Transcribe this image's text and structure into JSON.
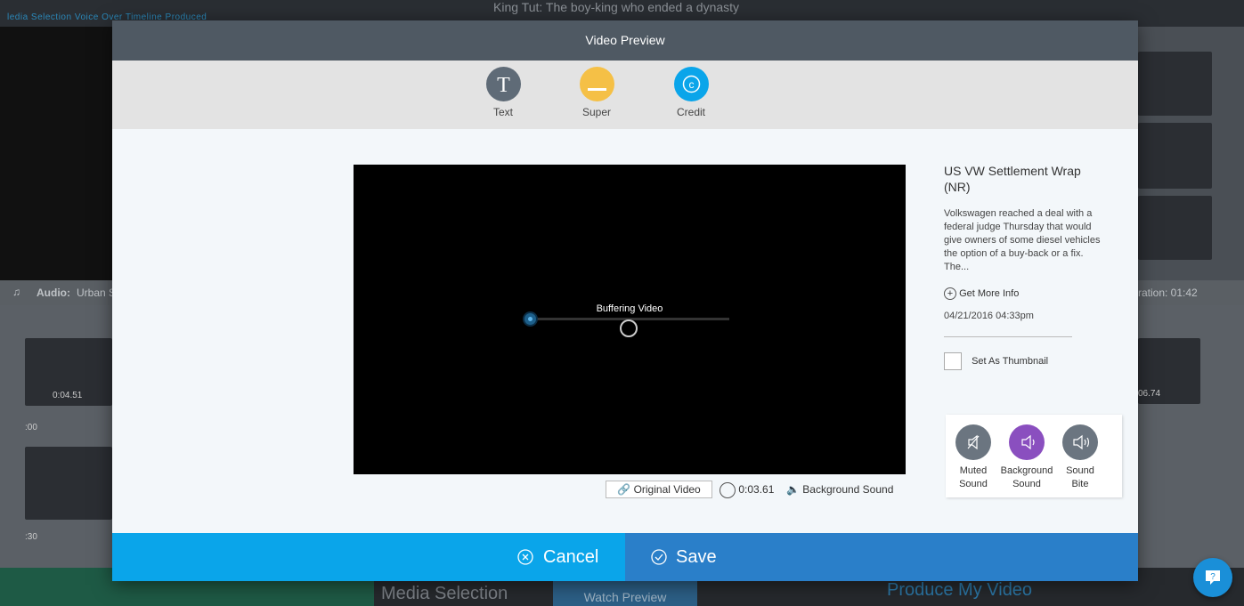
{
  "background": {
    "steps": "ledia Selection  Voice Over    Timeline     Produced",
    "project_title": "King Tut: The boy-king who ended a dynasty",
    "audio_label": "Audio:",
    "audio_value": "Urban S",
    "duration_label": "ration: 01:42",
    "clip1_time": "0:04.51",
    "clip2_time": "06.74",
    "tick1": ":00",
    "tick2": ":30",
    "footer_media": "Media Selection",
    "footer_watch": "Watch Preview",
    "footer_produce": "Produce My Video"
  },
  "modal": {
    "title": "Video Preview",
    "tools": [
      {
        "label": "Text",
        "color": "#5f6b77",
        "icon": "text-icon"
      },
      {
        "label": "Super",
        "color": "#f5c046",
        "icon": "super-icon"
      },
      {
        "label": "Credit",
        "color": "#0aa5ea",
        "icon": "copyright-icon"
      }
    ],
    "player": {
      "buffering_text": "Buffering Video"
    },
    "info": {
      "original_video": "Original Video",
      "duration": "0:03.61",
      "sound_type": "Background Sound"
    },
    "side": {
      "title": "US VW Settlement Wrap (NR)",
      "description": "Volkswagen reached a deal with a federal judge Thursday that would give owners of some diesel vehicles the option of a buy-back or a fix. The...",
      "more_info": "Get More Info",
      "date": "04/21/2016 04:33pm",
      "thumbnail_label": "Set As Thumbnail"
    },
    "sounds": [
      {
        "label1": "Muted",
        "label2": "Sound",
        "color": "#6b7580"
      },
      {
        "label1": "Background",
        "label2": "Sound",
        "color": "#8a4fbf"
      },
      {
        "label1": "Sound",
        "label2": "Bite",
        "color": "#6b7580"
      }
    ],
    "cancel_label": "Cancel",
    "save_label": "Save"
  }
}
